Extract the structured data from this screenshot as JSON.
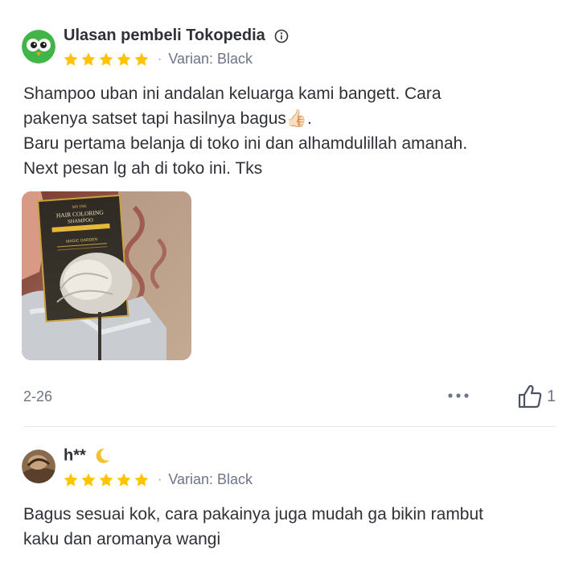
{
  "reviews": [
    {
      "reviewer": "Ulasan pembeli Tokopedia",
      "rating": 5,
      "variant": "Varian: Black",
      "text_lines": [
        "Shampoo uban ini andalan keluarga kami bangett. Cara",
        "pakenya satset tapi hasilnya bagus👍🏻.",
        "Baru pertama belanja di toko ini dan alhamdulillah amanah.",
        "Next pesan lg ah di toko ini. Tks"
      ],
      "photo": {
        "brand": "MY INK",
        "title_line1": "HAIR COLORING",
        "title_line2": "SHAMPOO",
        "subtitle": "MAGIC GARDEN"
      },
      "date": "2-26",
      "likes": "1"
    },
    {
      "reviewer": "h**",
      "rating": 5,
      "variant": "Varian: Black",
      "text_lines": [
        "Bagus sesuai kok, cara pakainya juga mudah ga bikin rambut",
        "kaku dan aromanya wangi"
      ]
    }
  ],
  "icons": {
    "star": "star-icon",
    "info": "info-icon",
    "more": "more-options-icon",
    "like": "thumbs-up-icon",
    "moon": "crescent-moon-icon"
  },
  "colors": {
    "star": "#ffc400",
    "brand_green": "#03ac0e",
    "text": "#2e3137",
    "muted": "#6d7588"
  }
}
